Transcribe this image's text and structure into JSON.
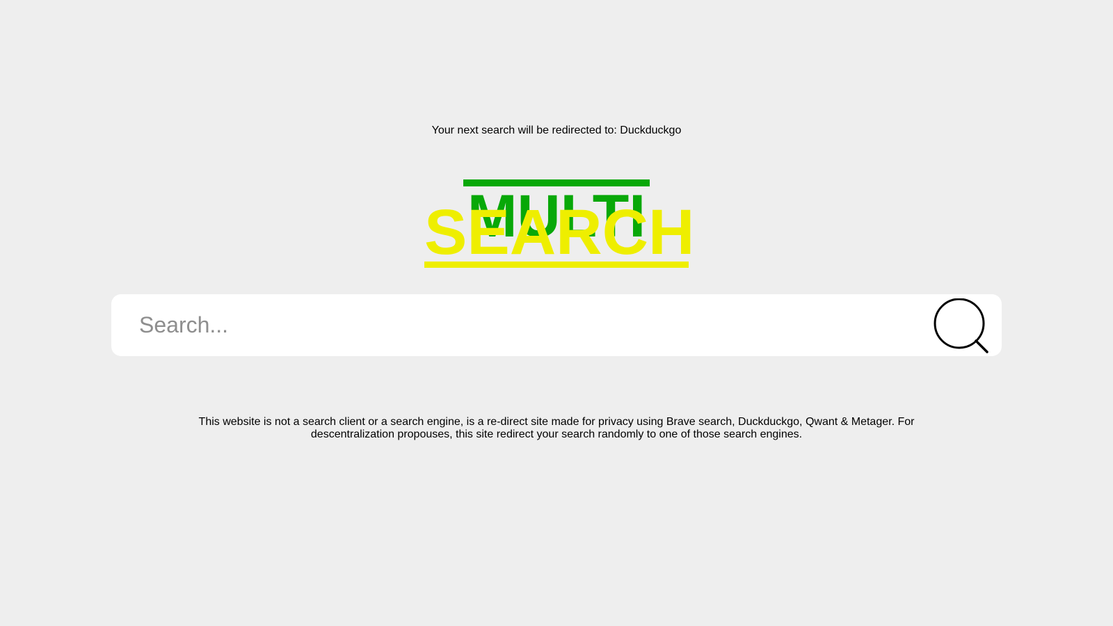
{
  "redirect_notice": "Your next search will be redirected to: Duckduckgo",
  "logo": {
    "line1": "MULTI",
    "line2": "SEARCH",
    "line1_color": "#08a808",
    "line2_color": "#eeee00"
  },
  "search": {
    "placeholder": "Search...",
    "value": "",
    "button_icon": "search-icon"
  },
  "disclaimer": "This website is not a search client or a search engine, is a re-direct site made for privacy using Brave search, Duckduckgo, Qwant & Metager. For descentralization propouses, this site redirect your search randomly to one of those search engines.",
  "colors": {
    "background": "#eeeeee",
    "search_bar": "#ffffff"
  }
}
